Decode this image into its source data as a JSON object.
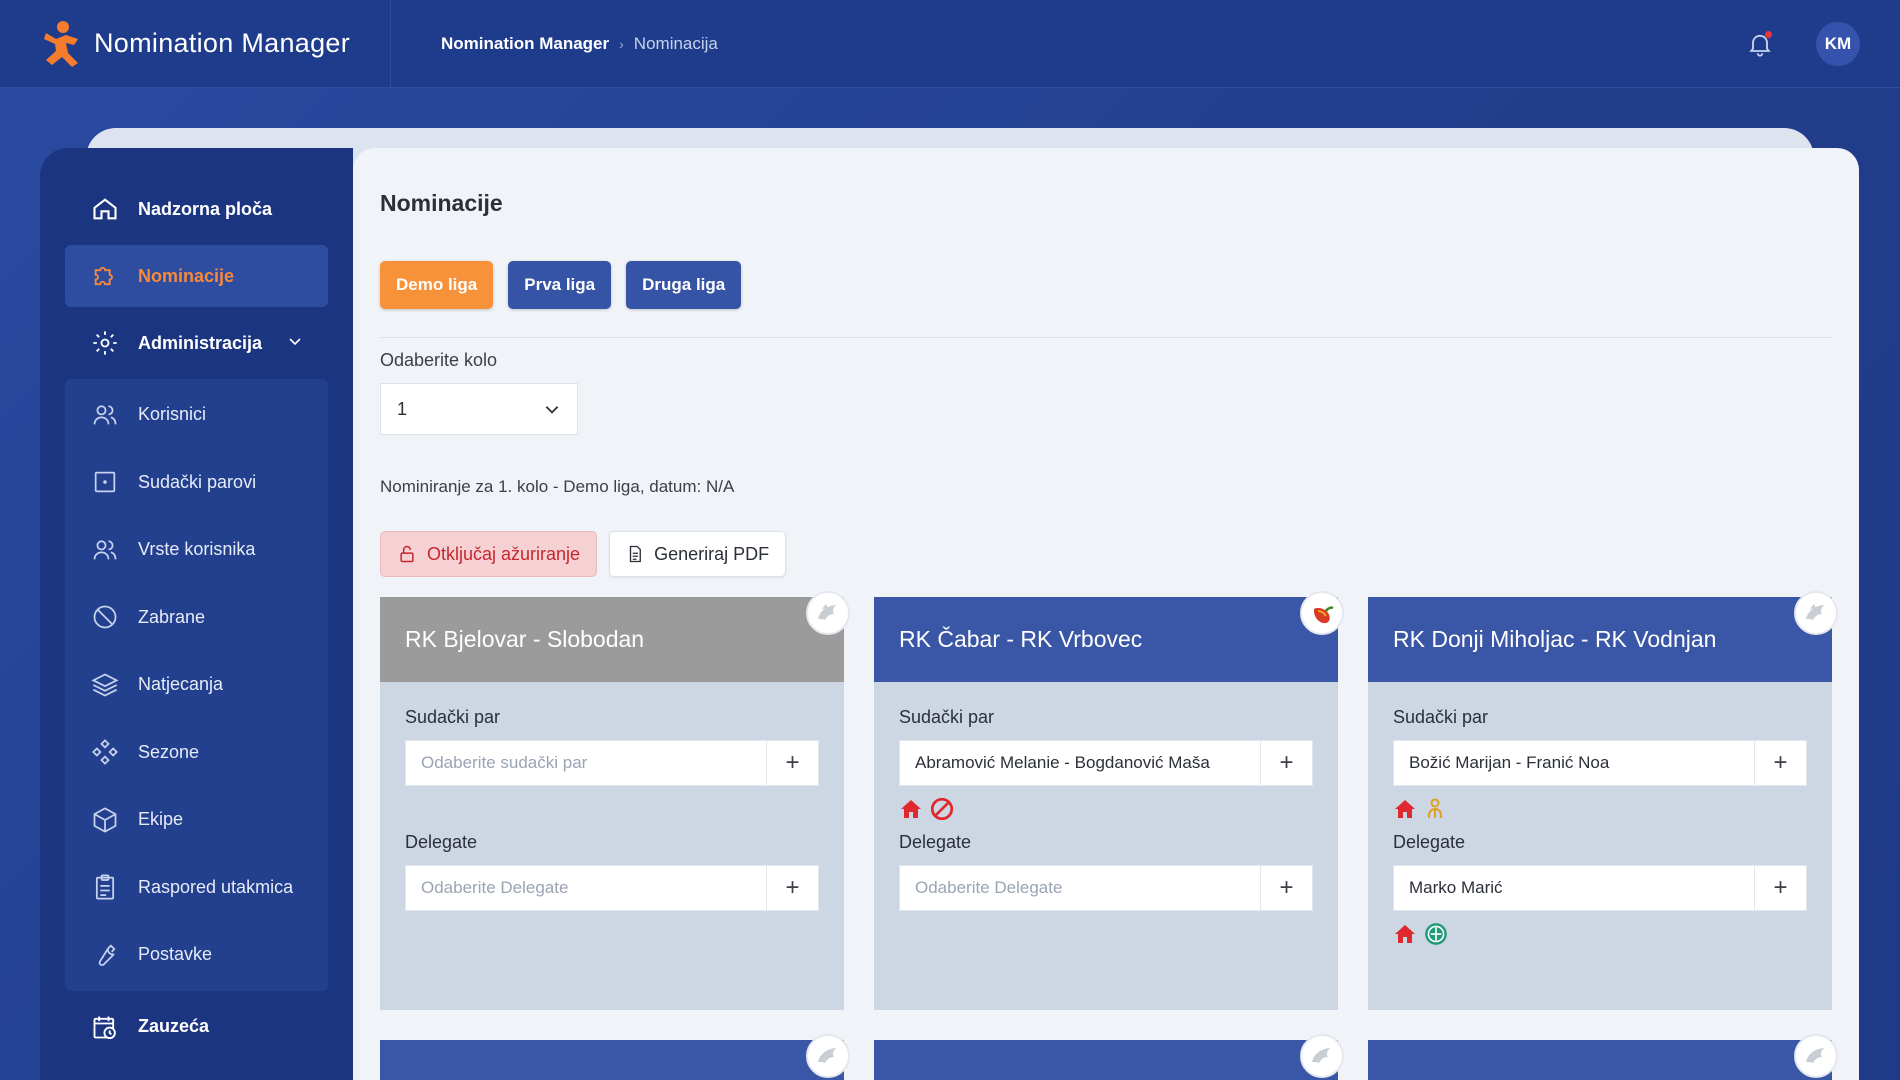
{
  "app": {
    "name": "Nomination Manager",
    "colors": {
      "brand_orange": "#f47c2c",
      "primary": "#3554a6",
      "danger": "#c8262f"
    }
  },
  "breadcrumb": {
    "root": "Nomination Manager",
    "separator": "›",
    "current": "Nominacija"
  },
  "user": {
    "initials": "KM",
    "has_notification": true
  },
  "sidebar": {
    "items": [
      {
        "label": "Nadzorna ploča",
        "icon": "home-icon"
      },
      {
        "label": "Nominacije",
        "icon": "puzzle-icon",
        "active": true
      },
      {
        "label": "Administracija",
        "icon": "gear-icon",
        "expandable": true
      }
    ],
    "admin_items": [
      {
        "label": "Korisnici",
        "icon": "users-icon"
      },
      {
        "label": "Sudački parovi",
        "icon": "dice-icon"
      },
      {
        "label": "Vrste korisnika",
        "icon": "users-icon"
      },
      {
        "label": "Zabrane",
        "icon": "ban-icon"
      },
      {
        "label": "Natjecanja",
        "icon": "layers-icon"
      },
      {
        "label": "Sezone",
        "icon": "diamonds-icon"
      },
      {
        "label": "Ekipe",
        "icon": "box-icon"
      },
      {
        "label": "Raspored utakmica",
        "icon": "clipboard-icon"
      },
      {
        "label": "Postavke",
        "icon": "wrench-icon"
      }
    ],
    "bottom_item": {
      "label": "Zauzeća",
      "icon": "calendar-clock-icon"
    }
  },
  "main": {
    "title": "Nominacije",
    "league_tabs": [
      {
        "label": "Demo liga",
        "active": true
      },
      {
        "label": "Prva liga"
      },
      {
        "label": "Druga liga"
      }
    ],
    "round_label": "Odaberite kolo",
    "round_value": "1",
    "info": "Nominiranje za 1. kolo - Demo liga, datum: N/A",
    "unlock_button": "Otključaj ažuriranje",
    "pdf_button": "Generiraj PDF",
    "cards": [
      {
        "match": "RK Bjelovar - Slobodan",
        "head": "gray",
        "badge": "wolf-icon",
        "referee_label": "Sudački par",
        "referee_value": "",
        "referee_placeholder": "Odaberite sudački par",
        "referee_icons": [],
        "delegate_label": "Delegate",
        "delegate_value": "",
        "delegate_placeholder": "Odaberite Delegate",
        "delegate_icons": []
      },
      {
        "match": "RK Čabar - RK Vrbovec",
        "head": "blue",
        "badge": "chili-icon",
        "referee_label": "Sudački par",
        "referee_value": "Abramović Melanie - Bogdanović Maša",
        "referee_placeholder": "",
        "referee_icons": [
          "home-icon",
          "ban-icon"
        ],
        "delegate_label": "Delegate",
        "delegate_value": "",
        "delegate_placeholder": "Odaberite Delegate",
        "delegate_icons": []
      },
      {
        "match": "RK Donji Miholjac - RK Vodnjan",
        "head": "blue",
        "badge": "wolf-icon",
        "referee_label": "Sudački par",
        "referee_value": "Božić Marijan - Franić Noa",
        "referee_placeholder": "",
        "referee_icons": [
          "home-icon",
          "person-pair-icon"
        ],
        "delegate_label": "Delegate",
        "delegate_value": "Marko Marić",
        "delegate_placeholder": "",
        "delegate_icons": [
          "home-icon",
          "emblem-icon"
        ]
      }
    ]
  }
}
